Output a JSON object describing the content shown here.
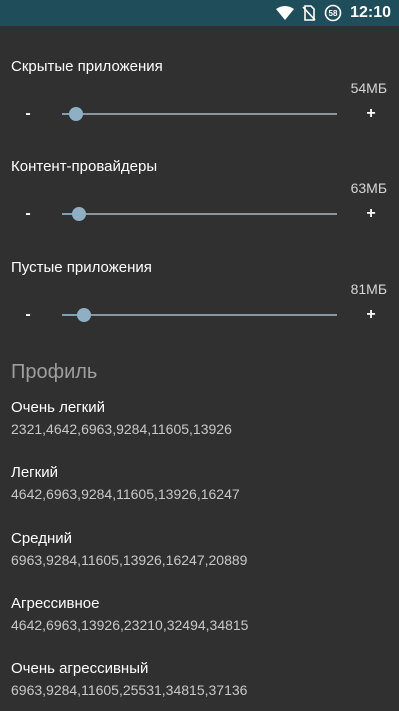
{
  "status_bar": {
    "time": "12:10",
    "icons": [
      "wifi-icon",
      "no-sim-icon",
      "data-saver-icon"
    ],
    "badge_text": "58"
  },
  "sliders": [
    {
      "title": "Скрытые приложения",
      "value": "54МБ",
      "position_fraction": 0.05,
      "minus": "-",
      "plus": "+"
    },
    {
      "title": "Контент-провайдеры",
      "value": "63МБ",
      "position_fraction": 0.06,
      "minus": "-",
      "plus": "+"
    },
    {
      "title": "Пустые приложения",
      "value": "81МБ",
      "position_fraction": 0.08,
      "minus": "-",
      "plus": "+"
    }
  ],
  "profile_section": {
    "header": "Профиль",
    "items": [
      {
        "name": "Очень легкий",
        "values": "2321,4642,6963,9284,11605,13926"
      },
      {
        "name": "Легкий",
        "values": "4642,6963,9284,11605,13926,16247"
      },
      {
        "name": "Средний",
        "values": "6963,9284,11605,13926,16247,20889"
      },
      {
        "name": "Агрессивное",
        "values": "4642,6963,13926,23210,32494,34815"
      },
      {
        "name": "Очень агрессивный",
        "values": "6963,9284,11605,25531,34815,37136"
      }
    ]
  },
  "colors": {
    "background": "#303030",
    "status_bar": "#1f4e5a",
    "slider_accent": "#8fb0c4",
    "track": "#8e959a"
  }
}
